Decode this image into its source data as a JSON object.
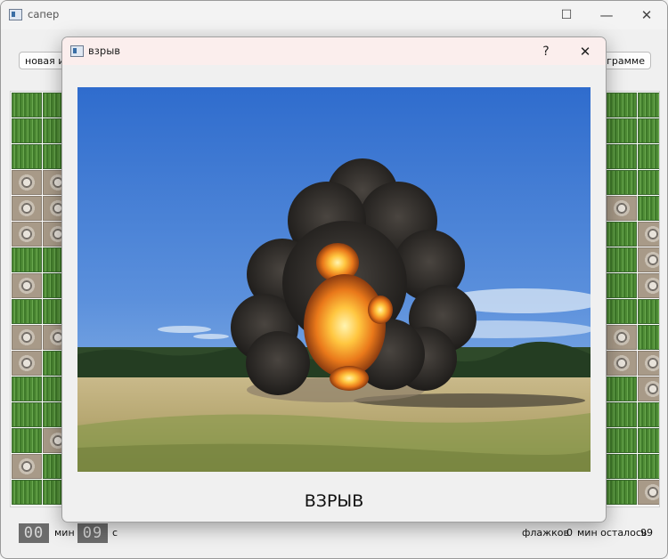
{
  "window": {
    "title": "сапер",
    "minimize_glyph": "—",
    "maximize_glyph": "☐",
    "close_glyph": "✕",
    "icon": "app-window-icon"
  },
  "toolbar": {
    "new_game_label": "новая иг",
    "about_label": "рограмме"
  },
  "board": {
    "left_columns": [
      [
        "grass",
        "grass",
        "grass",
        "mine",
        "mine",
        "mine",
        "grass",
        "mine",
        "grass",
        "mine",
        "mine",
        "grass",
        "grass",
        "grass",
        "mine",
        "grass"
      ],
      [
        "grass",
        "grass",
        "grass",
        "mine",
        "mine",
        "mine",
        "grass",
        "grass",
        "grass",
        "mine",
        "grass",
        "grass",
        "grass",
        "mine",
        "grass",
        "grass"
      ]
    ],
    "right_columns": [
      [
        "grass",
        "grass",
        "grass",
        "grass",
        "mine",
        "grass",
        "grass",
        "grass",
        "grass",
        "mine",
        "mine",
        "grass",
        "grass",
        "grass",
        "grass",
        "grass"
      ],
      [
        "grass",
        "grass",
        "grass",
        "grass",
        "grass",
        "mine",
        "mine",
        "mine",
        "grass",
        "grass",
        "mine",
        "mine",
        "grass",
        "grass",
        "grass",
        "mine"
      ]
    ]
  },
  "status": {
    "minutes_value": "00",
    "minutes_label": "мин",
    "seconds_value": "09",
    "seconds_label": "с",
    "flags_label": "флажков",
    "flags_value": "0",
    "mines_left_label": "мин осталось",
    "mines_left_value": "99"
  },
  "dialog": {
    "title": "взрыв",
    "help_glyph": "?",
    "close_glyph": "✕",
    "image_name": "explosion-photo",
    "caption": "ВЗРЫВ"
  },
  "colors": {
    "accent": "#fbeeed",
    "grass": "#5a9a40",
    "sky": "#3f78d0"
  }
}
